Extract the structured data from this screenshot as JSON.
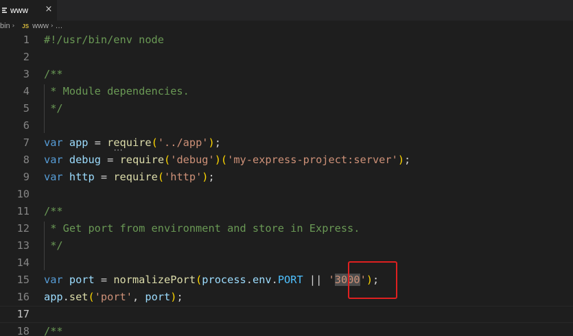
{
  "tab": {
    "label": "www",
    "close": "×",
    "icon": "list-icon"
  },
  "breadcrumb": {
    "items": [
      "bin",
      "www",
      "…"
    ],
    "file_type": "JS",
    "separator": "›"
  },
  "editor": {
    "active_line": 17,
    "lines": [
      {
        "n": "1",
        "tokens": [
          [
            "comment",
            "#!/usr/bin/env node"
          ]
        ]
      },
      {
        "n": "2",
        "tokens": []
      },
      {
        "n": "3",
        "tokens": [
          [
            "comment",
            "/**"
          ]
        ]
      },
      {
        "n": "4",
        "tokens": [
          [
            "comment",
            " * Module dependencies."
          ]
        ]
      },
      {
        "n": "5",
        "tokens": [
          [
            "comment",
            " */"
          ]
        ]
      },
      {
        "n": "6",
        "tokens": []
      },
      {
        "n": "7",
        "tokens": [
          [
            "keyword",
            "var"
          ],
          [
            "punct",
            " "
          ],
          [
            "var",
            "app"
          ],
          [
            "punct",
            " = "
          ],
          [
            "func",
            "require"
          ],
          [
            "bracket-y",
            "("
          ],
          [
            "str",
            "'../app'"
          ],
          [
            "bracket-y",
            ")"
          ],
          [
            "punct",
            ";"
          ]
        ]
      },
      {
        "n": "8",
        "tokens": [
          [
            "keyword",
            "var"
          ],
          [
            "punct",
            " "
          ],
          [
            "var",
            "debug"
          ],
          [
            "punct",
            " = "
          ],
          [
            "func",
            "require"
          ],
          [
            "bracket-y",
            "("
          ],
          [
            "str",
            "'debug'"
          ],
          [
            "bracket-y",
            ")("
          ],
          [
            "str",
            "'my-express-project:server'"
          ],
          [
            "bracket-y",
            ")"
          ],
          [
            "punct",
            ";"
          ]
        ]
      },
      {
        "n": "9",
        "tokens": [
          [
            "keyword",
            "var"
          ],
          [
            "punct",
            " "
          ],
          [
            "var",
            "http"
          ],
          [
            "punct",
            " = "
          ],
          [
            "func",
            "require"
          ],
          [
            "bracket-y",
            "("
          ],
          [
            "str",
            "'http'"
          ],
          [
            "bracket-y",
            ")"
          ],
          [
            "punct",
            ";"
          ]
        ]
      },
      {
        "n": "10",
        "tokens": []
      },
      {
        "n": "11",
        "tokens": [
          [
            "comment",
            "/**"
          ]
        ]
      },
      {
        "n": "12",
        "tokens": [
          [
            "comment",
            " * Get port from environment and store in Express."
          ]
        ]
      },
      {
        "n": "13",
        "tokens": [
          [
            "comment",
            " */"
          ]
        ]
      },
      {
        "n": "14",
        "tokens": []
      },
      {
        "n": "15",
        "tokens": [
          [
            "keyword",
            "var"
          ],
          [
            "punct",
            " "
          ],
          [
            "var",
            "port"
          ],
          [
            "punct",
            " = "
          ],
          [
            "func",
            "normalizePort"
          ],
          [
            "bracket-y",
            "("
          ],
          [
            "var",
            "process"
          ],
          [
            "punct",
            "."
          ],
          [
            "var",
            "env"
          ],
          [
            "punct",
            "."
          ],
          [
            "const",
            "PORT"
          ],
          [
            "punct",
            " || "
          ],
          [
            "str",
            "'"
          ],
          [
            "sel",
            "3000"
          ],
          [
            "str",
            "'"
          ],
          [
            "bracket-y",
            ")"
          ],
          [
            "punct",
            ";"
          ]
        ]
      },
      {
        "n": "16",
        "tokens": [
          [
            "var",
            "app"
          ],
          [
            "punct",
            "."
          ],
          [
            "func",
            "set"
          ],
          [
            "bracket-y",
            "("
          ],
          [
            "str",
            "'port'"
          ],
          [
            "punct",
            ", "
          ],
          [
            "var",
            "port"
          ],
          [
            "bracket-y",
            ")"
          ],
          [
            "punct",
            ";"
          ]
        ]
      },
      {
        "n": "17",
        "tokens": []
      },
      {
        "n": "18",
        "tokens": [
          [
            "comment",
            "/**"
          ]
        ]
      }
    ]
  },
  "colors": {
    "background": "#1e1e1e",
    "keyword": "#569cd6",
    "string": "#ce9178",
    "comment": "#6a9955",
    "function": "#dcdcaa",
    "variable": "#9cdcfe",
    "highlight_box": "#e02020"
  }
}
